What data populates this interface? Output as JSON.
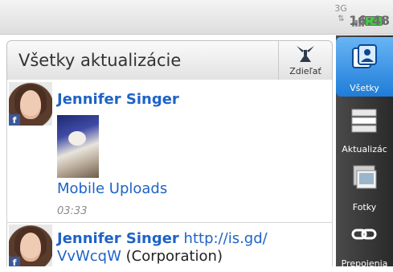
{
  "status_bar": {
    "network": "3G",
    "time": "16:48",
    "battery_color": "#3fcd3f"
  },
  "header": {
    "title": "Všetky aktualizácie",
    "share_label": "Zdieľať"
  },
  "feed": {
    "posts": [
      {
        "author": "Jennifer Singer",
        "album": "Mobile Uploads",
        "time": "03:33",
        "badge": "f"
      },
      {
        "author": "Jennifer Singer",
        "link": "http://is.gd/VvWcqW",
        "link_part1": "http://is.gd/",
        "link_part2": "VvWcqW",
        "suffix": " (Corporation)",
        "badge": "f"
      }
    ]
  },
  "tabs": [
    {
      "label": "Všetky",
      "icon": "people-icon",
      "active": true
    },
    {
      "label": "Aktualizác",
      "icon": "updates-icon",
      "active": false
    },
    {
      "label": "Fotky",
      "icon": "photos-icon",
      "active": false
    },
    {
      "label": "Prepojenia",
      "icon": "link-icon",
      "active": false
    }
  ],
  "colors": {
    "accent": "#1e63c7",
    "tab_active": "#3a8fe4"
  }
}
